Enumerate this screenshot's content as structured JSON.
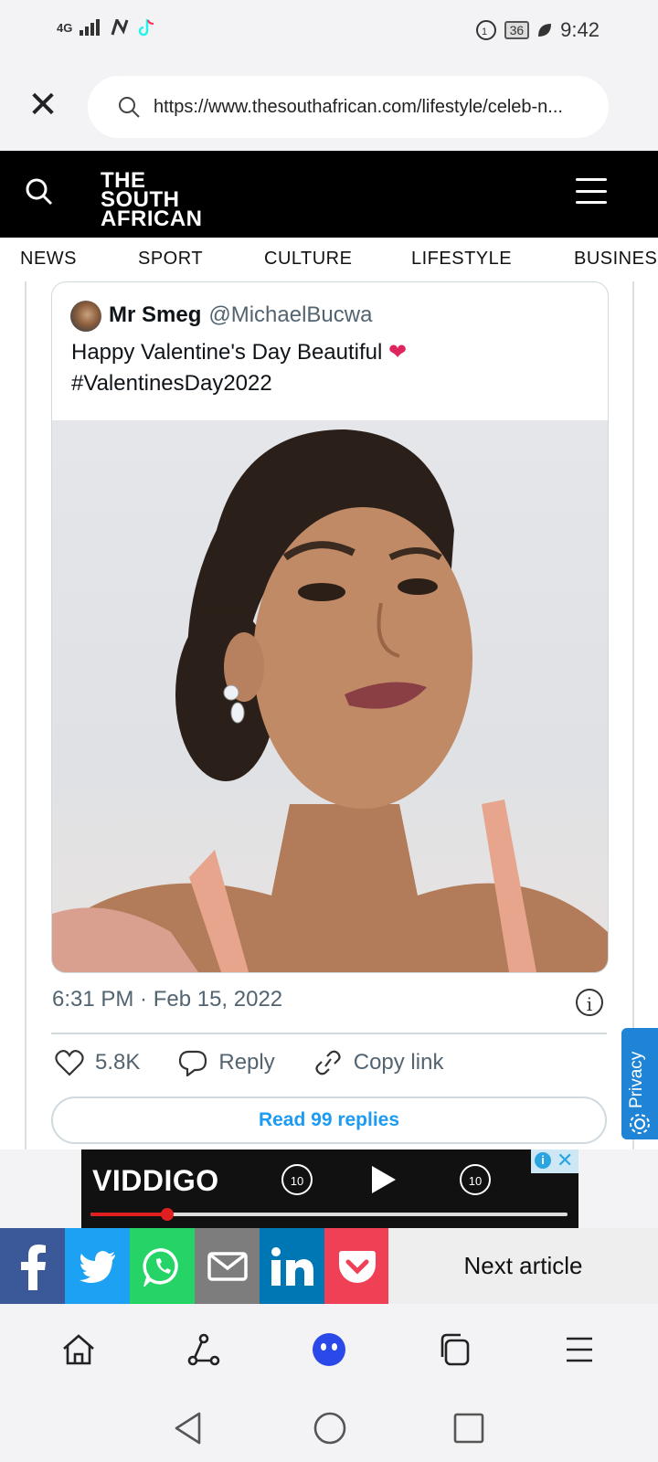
{
  "status_bar": {
    "network": "4G",
    "battery": "36",
    "time": "9:42"
  },
  "browser": {
    "url": "https://www.thesouthafrican.com/lifestyle/celeb-n..."
  },
  "site": {
    "logo_lines": [
      "THE",
      "SOUTH",
      "AFRICAN"
    ],
    "nav": [
      "NEWS",
      "SPORT",
      "CULTURE",
      "LIFESTYLE",
      "BUSINES"
    ]
  },
  "tweet": {
    "author_name": "Mr Smeg",
    "author_handle": "@MichaelBucwa",
    "text_line1": "Happy Valentine's Day Beautiful",
    "heart": "❤",
    "text_line2": "#ValentinesDay2022",
    "timestamp": "6:31 PM · Feb 15, 2022",
    "likes": "5.8K",
    "reply_label": "Reply",
    "copy_link_label": "Copy link",
    "read_replies": "Read 99 replies"
  },
  "privacy_tab": "Privacy",
  "ad": {
    "brand": "VIDDIGO",
    "rewind": "10",
    "forward": "10",
    "progress": 0.16
  },
  "share_bar": {
    "next_article": "Next article",
    "colors": {
      "facebook": "#3b5998",
      "twitter": "#1da1f2",
      "whatsapp": "#25d366",
      "email": "#7d7d7d",
      "linkedin": "#0077b5",
      "pocket": "#ef4056"
    }
  },
  "icons": [
    "close-icon",
    "search-icon",
    "menu-icon",
    "heart-icon",
    "reply-icon",
    "link-icon",
    "info-icon",
    "gear-icon",
    "home-icon",
    "share-icon",
    "assistant-icon",
    "tabs-icon",
    "menu-icon",
    "back-icon",
    "home-circle-icon",
    "recents-icon"
  ]
}
